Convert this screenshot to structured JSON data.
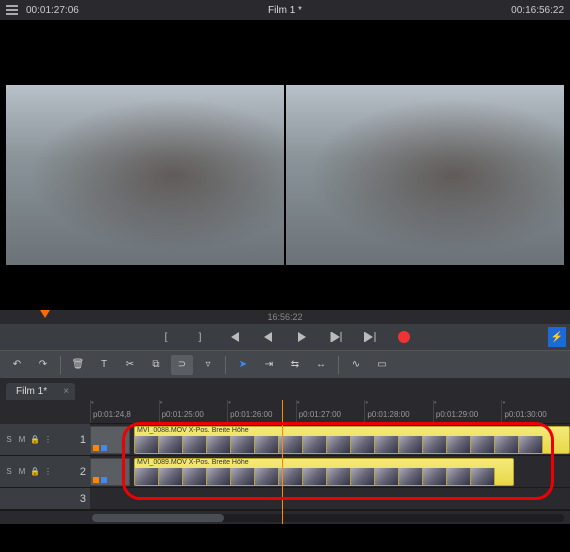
{
  "header": {
    "current_time": "00:01:27:06",
    "title": "Film 1 *",
    "total_time": "00:16:56:22"
  },
  "ruler": {
    "label": "16:56:22"
  },
  "transport": {
    "in": "[",
    "out": "]",
    "prev_key": "|◀",
    "step_back": "◀|",
    "play": "▶",
    "step_fwd": "▶|",
    "next_key": "▶|",
    "bolt": "⚡"
  },
  "tab": {
    "label": "Film 1*"
  },
  "time_ticks": [
    "p0:01:24,8",
    "p0:01:25:00",
    "p0:01:26:00",
    "p0:01:27:00",
    "p0:01:28:00",
    "p0:01:29:00",
    "p0:01:30:00"
  ],
  "tracks": [
    {
      "label_s": "S",
      "label_m": "M",
      "num": "1",
      "clip_label": "MVI_0088.MOV   X-Pos.  Breite  Höhe"
    },
    {
      "label_s": "S",
      "label_m": "M",
      "num": "2",
      "clip_label": "MVI_0089.MOV   X-Pos.  Breite  Höhe"
    },
    {
      "num": "3"
    }
  ]
}
